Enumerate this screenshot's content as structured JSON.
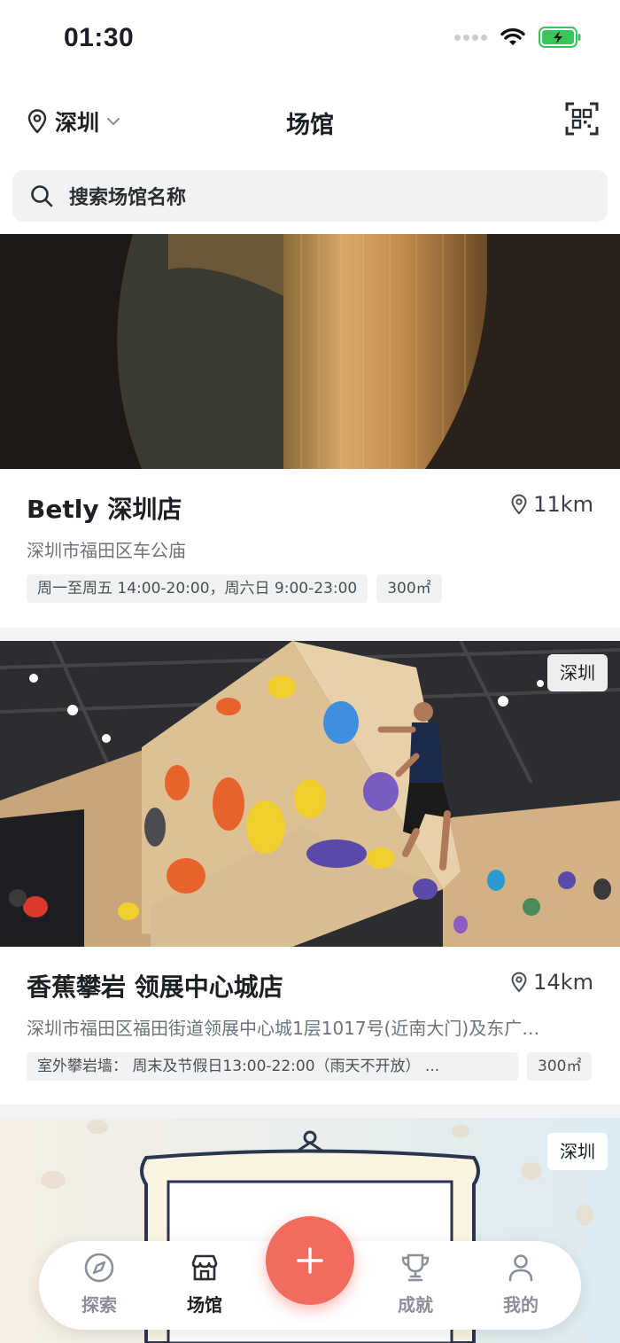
{
  "status_bar": {
    "time": "01:30"
  },
  "header": {
    "city": "深圳",
    "title": "场馆"
  },
  "search": {
    "placeholder": "搜索场馆名称"
  },
  "venues": [
    {
      "name": "Betly 深圳店",
      "distance": "11km",
      "address": "深圳市福田区车公庙",
      "tags": [
        "周一至周五 14:00-20:00，周六日 9:00-23:00",
        "300㎡"
      ]
    },
    {
      "name": "香蕉攀岩 领展中心城店",
      "distance": "14km",
      "address": "深圳市福田区福田街道领展中心城1层1017号(近南大门)及东广…",
      "tags": [
        "室外攀岩墙：  周末及节假日13:00-22:00（雨天不开放）      ...",
        "300㎡"
      ],
      "city_badge": "深圳"
    },
    {
      "city_badge": "深圳"
    }
  ],
  "nav": {
    "explore": "探索",
    "venues": "场馆",
    "achievements": "成就",
    "mine": "我的"
  },
  "colors": {
    "accent": "#f16b5f",
    "battery": "#34c759"
  },
  "icons": [
    "location-pin-icon",
    "chevron-down-icon",
    "qr-scan-icon",
    "search-icon",
    "compass-icon",
    "store-icon",
    "plus-icon",
    "trophy-icon",
    "user-icon",
    "wifi-icon",
    "battery-icon"
  ]
}
